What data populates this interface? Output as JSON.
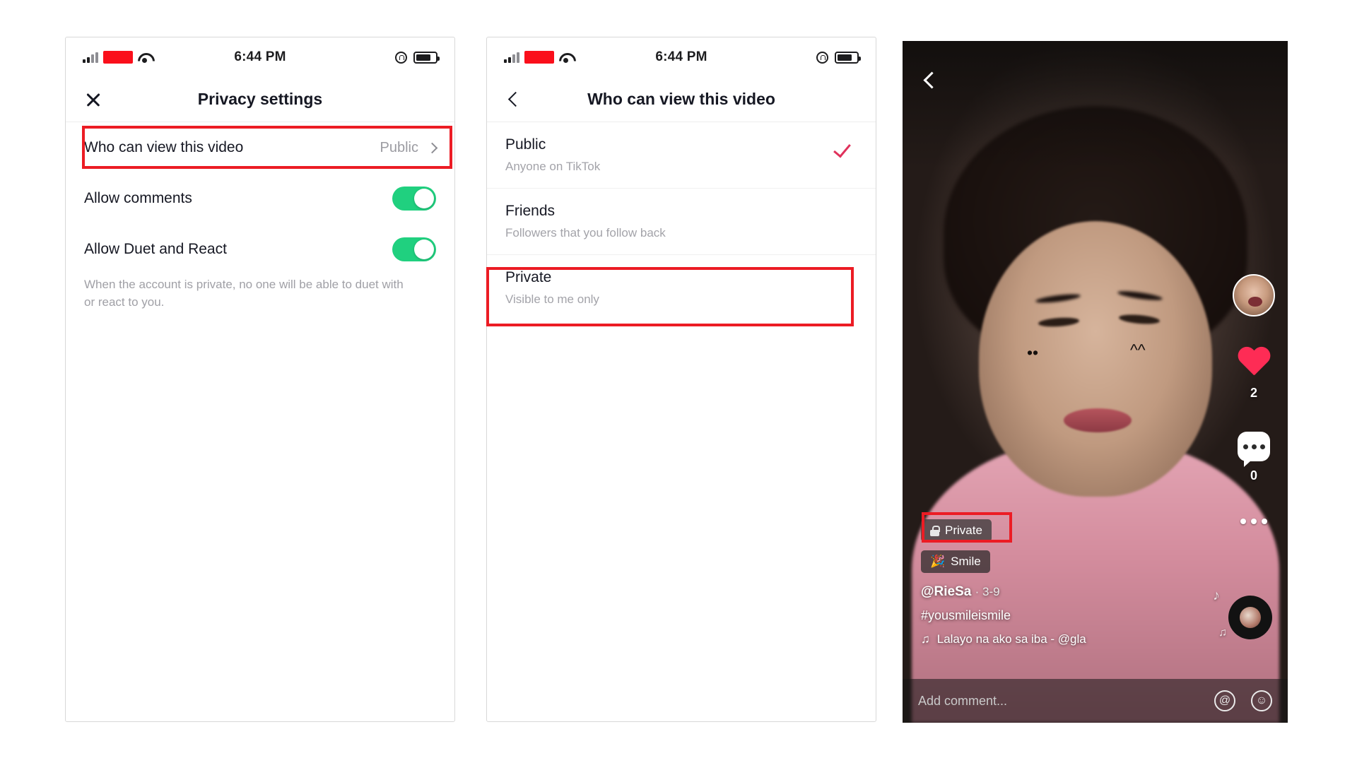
{
  "status_bar": {
    "time": "6:44 PM"
  },
  "panel1": {
    "nav": {
      "close_icon": "close-icon",
      "title": "Privacy settings"
    },
    "rows": [
      {
        "label": "Who can view this video",
        "value": "Public",
        "type": "link"
      },
      {
        "label": "Allow comments",
        "type": "toggle",
        "on": true
      },
      {
        "label": "Allow Duet and React",
        "type": "toggle",
        "on": true
      }
    ],
    "helper": "When the account is private, no one will be able to duet with or react to you."
  },
  "panel2": {
    "nav": {
      "back_icon": "chevron-left-icon",
      "title": "Who can view this video"
    },
    "options": [
      {
        "title": "Public",
        "subtitle": "Anyone on TikTok",
        "selected": true
      },
      {
        "title": "Friends",
        "subtitle": "Followers that you follow back",
        "selected": false
      },
      {
        "title": "Private",
        "subtitle": "Visible to me only",
        "selected": false
      }
    ]
  },
  "panel3": {
    "back_icon": "chevron-left-icon",
    "rail": {
      "avatar": "user-avatar",
      "like_count": "2",
      "comment_count": "0",
      "more_icon": "more-horizontal-icon"
    },
    "badges": [
      {
        "icon": "lock-icon",
        "label": "Private"
      },
      {
        "icon": "sparkle-icon",
        "label": "Smile"
      }
    ],
    "username": "@RieSa",
    "date": "· 3-9",
    "hashtag": "#yousmileismile",
    "music": "Lalayo na ako sa iba - @gla",
    "music_icon": "music-note-icon",
    "comment_bar": {
      "placeholder": "Add comment...",
      "mention_icon": "at-icon",
      "emoji_icon": "emoji-icon"
    }
  },
  "highlights": {
    "color": "#ec1c24",
    "items": [
      "who-can-view-this-video-row",
      "private-option",
      "private-badge"
    ]
  }
}
